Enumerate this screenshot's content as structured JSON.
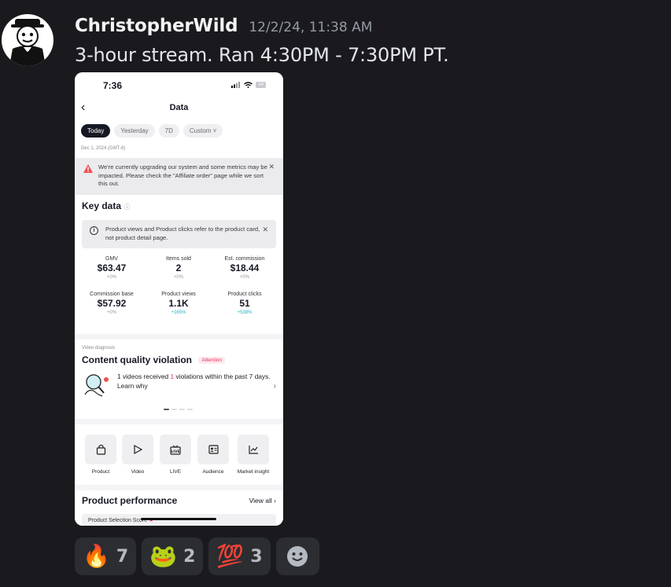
{
  "message": {
    "username": "ChristopherWild",
    "timestamp": "12/2/24, 11:38 AM",
    "text": "3-hour stream. Ran 4:30PM - 7:30PM PT."
  },
  "screenshot": {
    "time": "7:36",
    "battery": "14",
    "title": "Data",
    "tabs": [
      "Today",
      "Yesterday",
      "7D",
      "Custom"
    ],
    "date": "Dec 1, 2024 (GMT-8)",
    "warning": "We're currently upgrading our system and some metrics may be impacted. Please check the \"Affiliate order\" page while we sort this out.",
    "key_data_title": "Key data",
    "info_note": "Product views and Product clicks refer to the product card, not product detail page.",
    "metrics": [
      {
        "label": "GMV",
        "value": "$63.47",
        "delta": "+0%"
      },
      {
        "label": "Items sold",
        "value": "2",
        "delta": "+0%"
      },
      {
        "label": "Est. commission",
        "value": "$18.44",
        "delta": "+0%"
      },
      {
        "label": "Commission base",
        "value": "$57.92",
        "delta": "+0%"
      },
      {
        "label": "Product views",
        "value": "1.1K",
        "delta": "+165%"
      },
      {
        "label": "Product clicks",
        "value": "51",
        "delta": "+538%"
      }
    ],
    "video_diagnosis_label": "Video diagnosis",
    "violation_title": "Content quality violation",
    "attention_badge": "Attention",
    "violation_text_a": "1 videos received",
    "violation_count": "1",
    "violation_text_b": "violations within the past 7 days. Learn why",
    "tools": [
      "Product",
      "Video",
      "LIVE",
      "Audience",
      "Market insight"
    ],
    "product_performance": "Product performance",
    "view_all": "View all",
    "selection_score": "Product Selection Score"
  },
  "reactions": [
    {
      "emoji": "🔥",
      "count": "7"
    },
    {
      "emoji": "🐸",
      "count": "2"
    },
    {
      "emoji": "💯",
      "count": "3"
    }
  ],
  "colors": {
    "background": "#1a1a1e",
    "reaction_bg": "#2b2d31",
    "accent_up": "#20b0c8",
    "attention": "#e8335a"
  }
}
